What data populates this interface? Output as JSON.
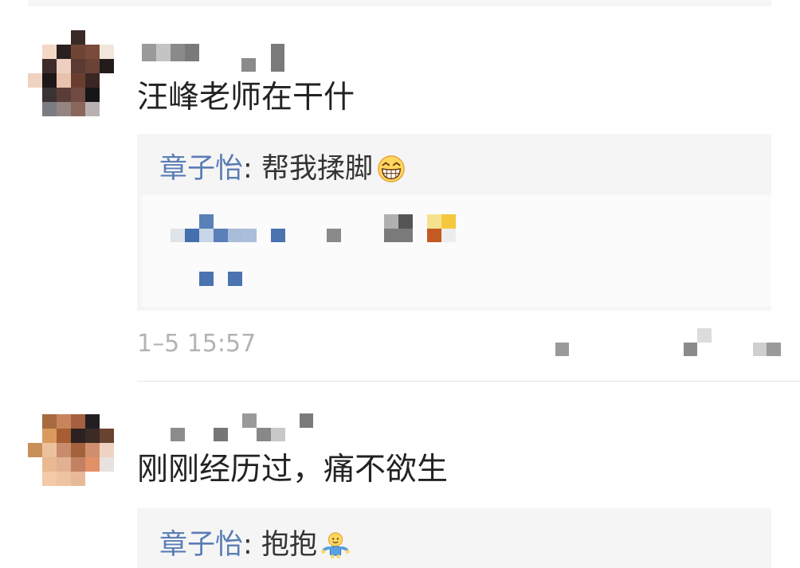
{
  "comments": [
    {
      "avatar_mosaic": [
        [
          null,
          null,
          null,
          "#3a2a25",
          null,
          null
        ],
        [
          null,
          "#f2d8c5",
          "#2a2020",
          "#6e4535",
          "#7a4a3a",
          "#f2e6dc"
        ],
        [
          null,
          "#3d2c2a",
          "#efd0c0",
          "#5a3a32",
          "#6b4236",
          "#241c1c"
        ],
        [
          "#f0d2c0",
          "#1e1718",
          "#e8c2ad",
          "#6a3e2f",
          "#3b2624",
          null
        ],
        [
          null,
          "#3a3335",
          "#5b3d37",
          "#6f4b41",
          "#161616",
          null
        ],
        [
          null,
          "#7b7b82",
          "#958581",
          "#8a675c",
          "#b9b1b1",
          null
        ]
      ],
      "text": "汪峰老师在干什",
      "reply": {
        "author": "章子怡",
        "separator": ": ",
        "text": "帮我揉脚",
        "emoji": "grinning-face-icon"
      },
      "time": "1–5 15:57"
    },
    {
      "avatar_mosaic": [
        [
          null,
          "#a86a40",
          "#c8845a",
          "#a46040",
          "#221e22",
          null
        ],
        [
          null,
          "#d99a60",
          "#a85c32",
          "#2b2121",
          "#3c2a24",
          "#6a4230"
        ],
        [
          "#c98f5a",
          "#ebc29c",
          "#c98b6b",
          "#a3623c",
          "#cf8f6f",
          "#f0d2c2"
        ],
        [
          null,
          "#e9b992",
          "#e1b192",
          "#c18162",
          "#e29068",
          "#e8e1dd"
        ],
        [
          null,
          "#f2c9a9",
          "#eec3a1",
          "#e8b998",
          null,
          null
        ]
      ],
      "text": "刚刚经历过，痛不欲生",
      "reply": {
        "author": "章子怡",
        "separator": ": ",
        "text": "抱抱",
        "emoji": "hug-icon"
      }
    }
  ],
  "colors": {
    "author_link": "#5b7db5",
    "comment_text": "#222222",
    "reply_text": "#333333",
    "meta_text": "#b3b3b3",
    "reply_background": "#f5f5f5",
    "divider": "#e6e6e6"
  }
}
